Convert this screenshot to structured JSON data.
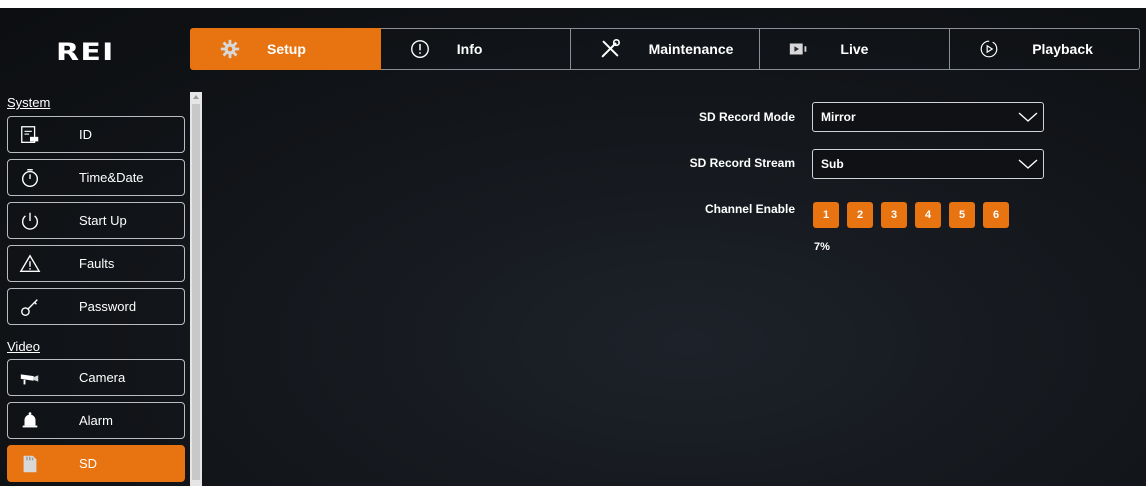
{
  "brand": {
    "logo_text": "REI"
  },
  "tabs": [
    {
      "label": "Setup",
      "icon": "gear-icon",
      "active": true
    },
    {
      "label": "Info",
      "icon": "info-icon",
      "active": false
    },
    {
      "label": "Maintenance",
      "icon": "tools-icon",
      "active": false
    },
    {
      "label": "Live",
      "icon": "video-camera-icon",
      "active": false
    },
    {
      "label": "Playback",
      "icon": "play-circle-icon",
      "active": false
    }
  ],
  "sidebar": {
    "sections": [
      {
        "title": "System",
        "items": [
          {
            "label": "ID",
            "icon": "id-card-icon"
          },
          {
            "label": "Time&Date",
            "icon": "stopwatch-icon"
          },
          {
            "label": "Start Up",
            "icon": "power-icon"
          },
          {
            "label": "Faults",
            "icon": "warning-icon"
          },
          {
            "label": "Password",
            "icon": "key-icon"
          }
        ]
      },
      {
        "title": "Video",
        "items": [
          {
            "label": "Camera",
            "icon": "cctv-camera-icon"
          },
          {
            "label": "Alarm",
            "icon": "bell-icon"
          },
          {
            "label": "SD",
            "icon": "sd-card-icon",
            "active": true
          }
        ]
      }
    ]
  },
  "form": {
    "record_mode": {
      "label": "SD Record Mode",
      "value": "Mirror"
    },
    "record_stream": {
      "label": "SD Record Stream",
      "value": "Sub"
    },
    "channel_enable": {
      "label": "Channel Enable",
      "channels": [
        "1",
        "2",
        "3",
        "4",
        "5",
        "6"
      ]
    },
    "usage_text": "7%"
  },
  "colors": {
    "accent": "#e87311",
    "background": "#121519",
    "border": "#b9bdc2"
  }
}
